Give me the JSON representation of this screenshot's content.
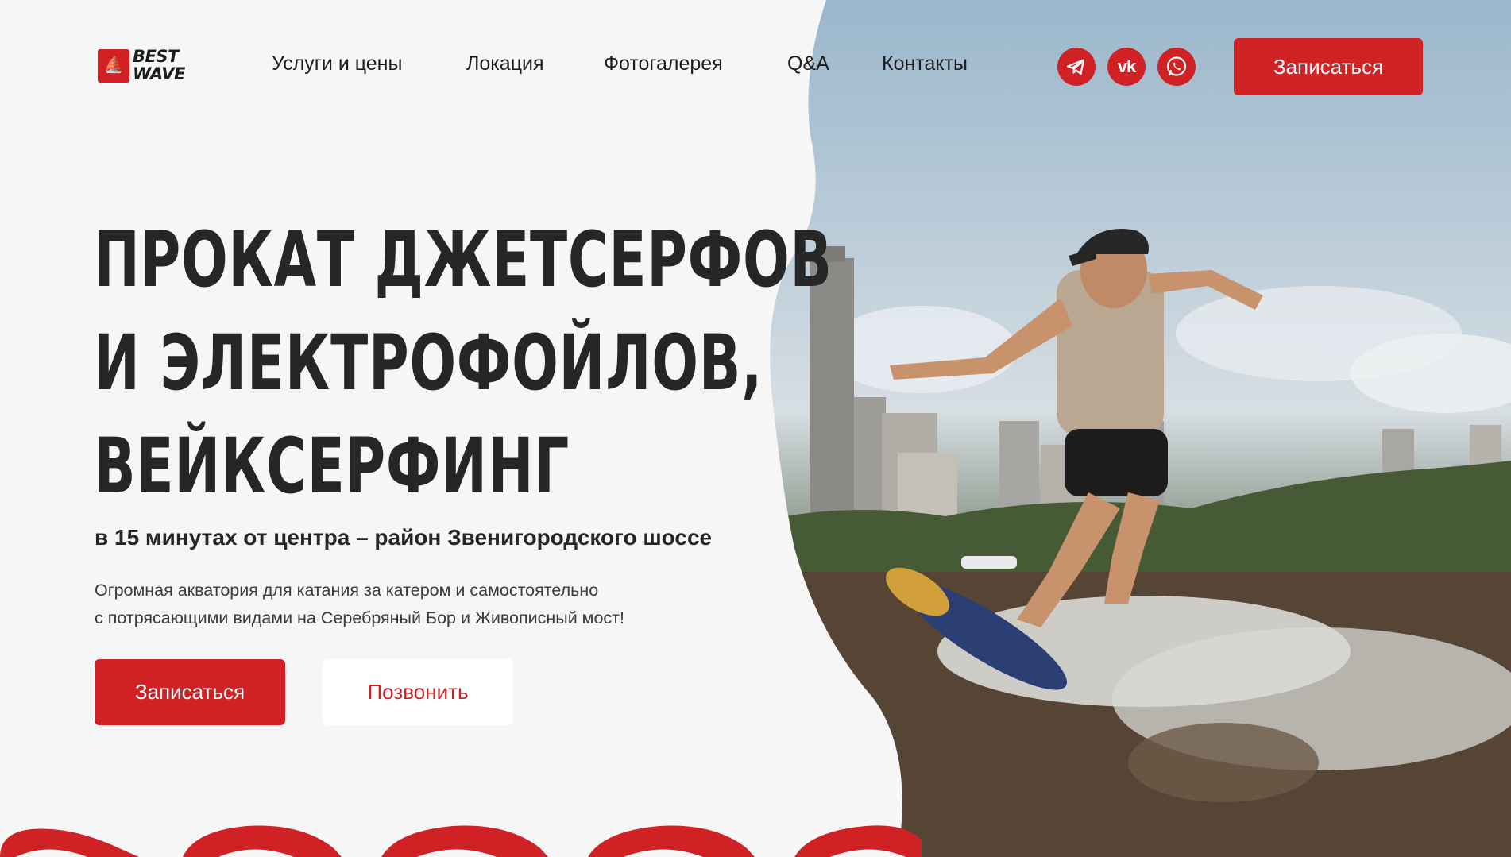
{
  "brand": {
    "logo_line1": "BEST",
    "logo_line2": "WAVE",
    "accent_color": "#d02125"
  },
  "nav": {
    "items": [
      "Услуги и цены",
      "Локация",
      "Фотогалерея",
      "Q&A",
      "Контакты"
    ]
  },
  "social": {
    "telegram_icon": "telegram-icon",
    "vk_label": "vk",
    "whatsapp_icon": "whatsapp-icon"
  },
  "header": {
    "cta_label": "Записаться"
  },
  "hero": {
    "headline_lines": [
      "ПРОКАТ ДЖЕТСЕРФОВ",
      "И ЭЛЕКТРОФОЙЛОВ,",
      "ВЕЙКСЕРФИНГ"
    ],
    "subtitle": "в 15 минутах от центра – район Звенигородского шоссе",
    "description_lines": [
      "Огромная акватория для катания за катером и самостоятельно",
      "с потрясающими видами на Серебряный Бор и Живописный мост!"
    ],
    "primary_button": "Записаться",
    "secondary_button": "Позвонить",
    "photo_description_icon": "wakesurfer-photo"
  }
}
